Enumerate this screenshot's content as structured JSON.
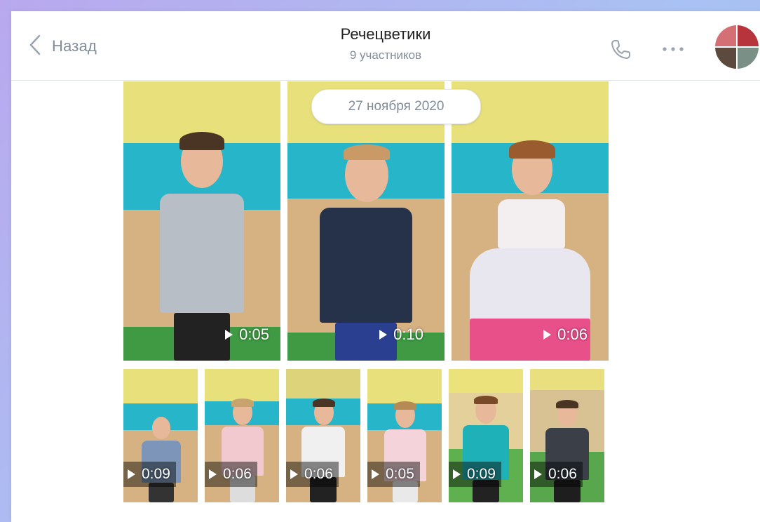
{
  "header": {
    "back_label": "Назад",
    "title": "Речецветики",
    "subtitle": "9 участников"
  },
  "date_separator": "27 ноября 2020",
  "videos_large": [
    {
      "duration": "0:05",
      "shirt": "#b8bec6",
      "pants": "#222"
    },
    {
      "duration": "0:10",
      "shirt": "#26324a",
      "pants": "#2a3f8f"
    },
    {
      "duration": "0:06",
      "shirt": "#f3eef0",
      "pants": "#e8508a"
    }
  ],
  "videos_small": [
    {
      "duration": "0:09",
      "shirt": "#7c95b9"
    },
    {
      "duration": "0:06",
      "shirt": "#f2c9cf"
    },
    {
      "duration": "0:06",
      "shirt": "#f0f0f0"
    },
    {
      "duration": "0:05",
      "shirt": "#f4d3da"
    },
    {
      "duration": "0:09",
      "shirt": "#1fb1b8"
    },
    {
      "duration": "0:06",
      "shirt": "#3a3f48"
    }
  ],
  "icons": {
    "back": "chevron-left-icon",
    "call": "phone-icon",
    "more": "more-icon",
    "play": "play-icon"
  },
  "colors": {
    "background_gradient": [
      "#b9a8ee",
      "#a9c2f3"
    ],
    "muted_text": "#818c99",
    "title_text": "#222222"
  }
}
